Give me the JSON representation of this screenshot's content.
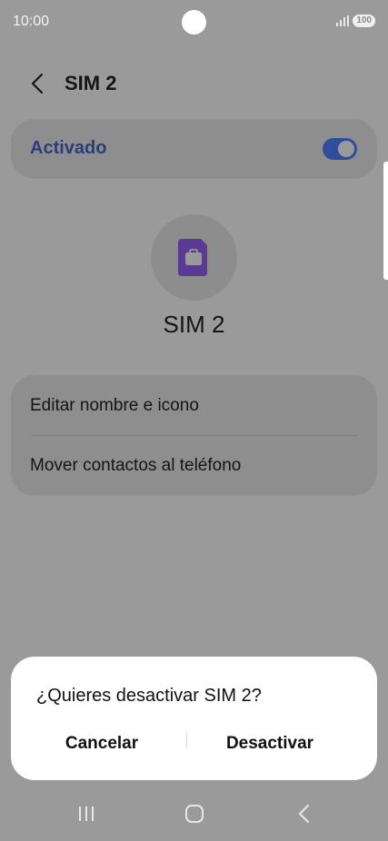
{
  "status_bar": {
    "time": "10:00",
    "battery": "100"
  },
  "header": {
    "title": "SIM 2"
  },
  "toggle": {
    "label": "Activado",
    "on": true
  },
  "sim": {
    "name": "SIM 2",
    "icon": "sim-card-briefcase-icon"
  },
  "options": [
    {
      "label": "Editar nombre e icono"
    },
    {
      "label": "Mover contactos al teléfono"
    }
  ],
  "dialog": {
    "title": "¿Quieres desactivar SIM 2?",
    "cancel_label": "Cancelar",
    "confirm_label": "Desactivar"
  },
  "nav": {
    "recent": "recent-apps-icon",
    "home": "home-icon",
    "back": "back-icon"
  },
  "colors": {
    "accent": "#2f4f9b",
    "sim_icon": "#5b3a94",
    "dim_overlay": "#9a9a9a"
  }
}
